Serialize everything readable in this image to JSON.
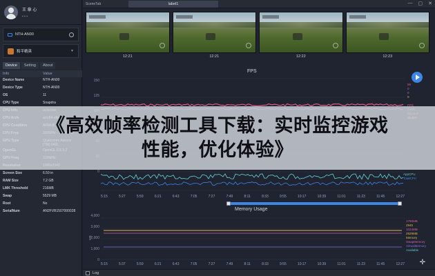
{
  "profile": {
    "name": "王 章 心",
    "subtitle": "▪ ▪ ▪"
  },
  "device_select": {
    "value": "NTH-AN00"
  },
  "app_select": {
    "value": "和平精英"
  },
  "tabs": [
    "Device",
    "Setting",
    "About"
  ],
  "info_table": {
    "headers": [
      "Info",
      "Value"
    ],
    "rows": [
      [
        "Device Name",
        "NTH-AN00"
      ],
      [
        "Device Type",
        "NTH-AN00"
      ],
      [
        "OS",
        "11"
      ],
      [
        "CPU Type",
        "Snapdra"
      ],
      [
        "CPU Info",
        "octacore"
      ],
      [
        "CPU Arch",
        "arm64-v8a"
      ],
      [
        "CPU Condition",
        "ARMv8l"
      ],
      [
        "CPU Freq",
        "300MHz - 1804MHz"
      ],
      [
        "GPU Type",
        "Qualcomm Adreno (TM) 642L"
      ],
      [
        "OpenGL",
        "OpenGL ES 3.2"
      ],
      [
        "GPU Freq",
        "315MHz"
      ],
      [
        "Resolution",
        "1080x2340"
      ],
      [
        "Screen Size",
        "6.59 in"
      ],
      [
        "RAM Size",
        "7.2 GB"
      ],
      [
        "LMK Threshold",
        "216MB"
      ],
      [
        "Swap",
        "5529 MB"
      ],
      [
        "Root",
        "No"
      ],
      [
        "SerialNum",
        "AN2FVB1507000028"
      ]
    ]
  },
  "toolbar": {
    "scene_tab": "SceneTab",
    "label_tab": "label1"
  },
  "window_controls": {
    "minimize": "—",
    "maximize": "▢",
    "close": "✕"
  },
  "thumbnails": [
    "12:21",
    "12:21",
    "12:22",
    "12:23"
  ],
  "fps_chart": {
    "title": "FPS",
    "y_ticks": [
      "150",
      "125",
      "100",
      "75",
      "50",
      "25",
      "0"
    ],
    "x_ticks": [
      "5:15",
      "5:27",
      "5:59",
      "6:21",
      "6:43",
      "7:05",
      "7:27",
      "7:49",
      "8:11",
      "8:33",
      "9:55",
      "10:17",
      "10:39",
      "11:01",
      "11:23",
      "11:45",
      "12:27"
    ],
    "legend_right": [
      "FPS",
      "JANK",
      "BigJank",
      "Stutter",
      "CPU",
      "AppCPU",
      "TotalCPU"
    ],
    "legend_values": [
      "59",
      "0",
      "0",
      "0"
    ]
  },
  "memory_chart": {
    "title": "Memory Usage",
    "y_ticks": [
      "4,000",
      "3,000",
      "2,000",
      "1,000",
      "0"
    ],
    "ylabel": "MB",
    "x_ticks": [
      "5:15",
      "5:37",
      "5:59",
      "6:21",
      "6:43",
      "7:05",
      "7:27",
      "7:49",
      "8:11",
      "8:33",
      "9:55",
      "10:17",
      "10:39",
      "11:01",
      "11:23",
      "11:45",
      "12:27"
    ],
    "legend_values": [
      "1790MB",
      "2945",
      "1024MB",
      "2929MB"
    ],
    "legend_labels": [
      "Memory",
      "SwapMemory",
      "VirtualMemory",
      "Available"
    ]
  },
  "bottom": {
    "log_label": "Log"
  },
  "banner": {
    "line1": "《高效帧率检测工具下载：实时监控游戏",
    "line2": "性能，优化体验》"
  },
  "colors": {
    "accent": "#3d86e8",
    "fps_line": "#e05a8a",
    "cpu_line": "#5fc7c9",
    "mem_line": "#e0b94a",
    "swap_line": "#d45fb0"
  }
}
